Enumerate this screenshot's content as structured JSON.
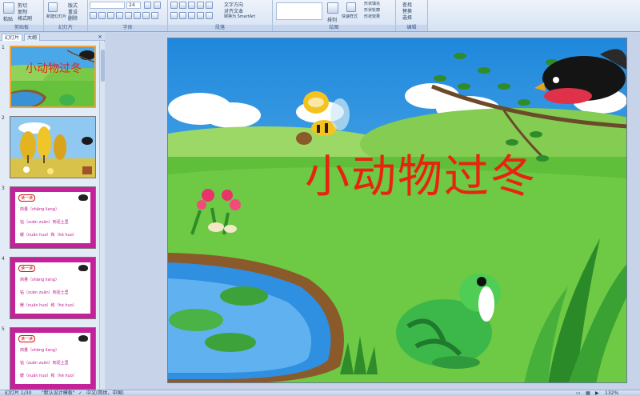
{
  "ribbon": {
    "groups": {
      "clipboard": "剪贴板",
      "slides": "幻灯片",
      "font": "字体",
      "paragraph": "段落",
      "drawing": "绘图",
      "editing": "编辑"
    },
    "buttons": {
      "paste": "粘贴",
      "cut": "剪切",
      "copy": "复制",
      "format_painter": "格式刷",
      "new_slide": "新建幻灯片",
      "layout": "版式",
      "reset": "重设",
      "delete": "删除",
      "text_direction": "文字方向",
      "align_text": "对齐文本",
      "smartart": "转换为 SmartArt",
      "arrange": "排列",
      "quick_styles": "快速样式",
      "shape_fill": "形状填充",
      "shape_outline": "形状轮廓",
      "shape_effects": "形状效果",
      "find": "查找",
      "replace": "替换",
      "select": "选择"
    },
    "font_size": "24"
  },
  "panel": {
    "tabs": [
      "幻灯片",
      "大纲"
    ]
  },
  "thumbnails": [
    {
      "num": "1",
      "title": "小动物过冬"
    },
    {
      "num": "2"
    },
    {
      "num": "3",
      "tag": "读一读",
      "lines": [
        "商量（shāng liang）",
        "钻（zuān zuān）到泥土里",
        "暖（nuǎn huo）和（hé huo）"
      ]
    },
    {
      "num": "4",
      "tag": "读一读",
      "lines": [
        "商量（shāng liang）",
        "钻（zuān zuān）到泥土里",
        "暖（nuǎn huo）和（hé huo）"
      ]
    },
    {
      "num": "5",
      "tag": "读一读",
      "lines": [
        "商量（shāng liang）",
        "钻（zuān zuān）到泥土里",
        "暖（nuǎn huo）和（hé huo）"
      ]
    }
  ],
  "slide": {
    "title": "小动物过冬"
  },
  "status": {
    "slide_counter": "幻灯片 1/30",
    "theme": "\"默认设计模板\"",
    "language": "中文(简体，中国)",
    "zoom": "132%"
  },
  "colors": {
    "title": "#e8230f",
    "sky": "#3aa0e6",
    "grass": "#5fbf3a",
    "selection": "#f2a33a",
    "lesson_border": "#c4229a"
  }
}
